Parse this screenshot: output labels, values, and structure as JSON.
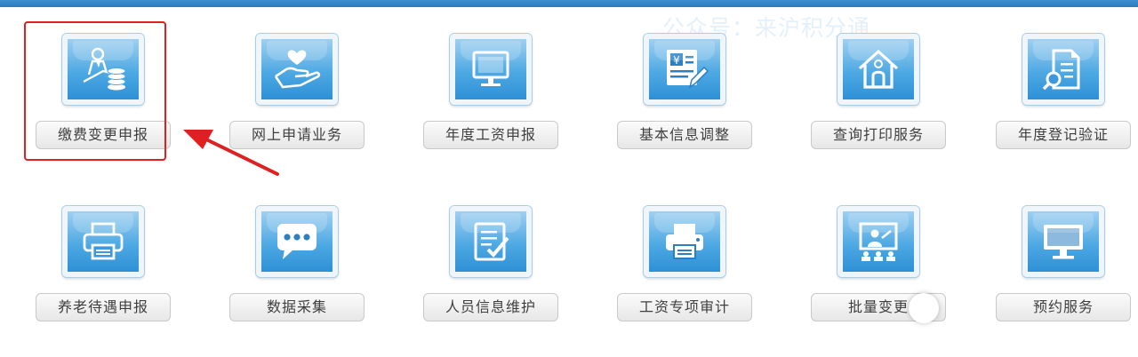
{
  "watermark": "公众号：来沪积分通",
  "colors": {
    "top_bar": "#2b7abf",
    "icon_blue": "#4ea9e3",
    "highlight_border": "#e02020",
    "arrow": "#e02020"
  },
  "tiles": [
    {
      "label": "缴费变更申报",
      "icon": "person-coins-icon"
    },
    {
      "label": "网上申请业务",
      "icon": "hand-heart-icon"
    },
    {
      "label": "年度工资申报",
      "icon": "monitor-icon"
    },
    {
      "label": "基本信息调整",
      "icon": "yen-document-pen-icon"
    },
    {
      "label": "查询打印服务",
      "icon": "house-person-icon"
    },
    {
      "label": "年度登记验证",
      "icon": "document-search-icon"
    },
    {
      "label": "养老待遇申报",
      "icon": "printer-icon"
    },
    {
      "label": "数据采集",
      "icon": "chat-bubble-icon"
    },
    {
      "label": "人员信息维护",
      "icon": "checklist-icon"
    },
    {
      "label": "工资专项审计",
      "icon": "printer-icon"
    },
    {
      "label": "批量变更",
      "icon": "presentation-icon"
    },
    {
      "label": "预约服务",
      "icon": "monitor-icon"
    }
  ],
  "highlighted_tile": "缴费变更申报"
}
